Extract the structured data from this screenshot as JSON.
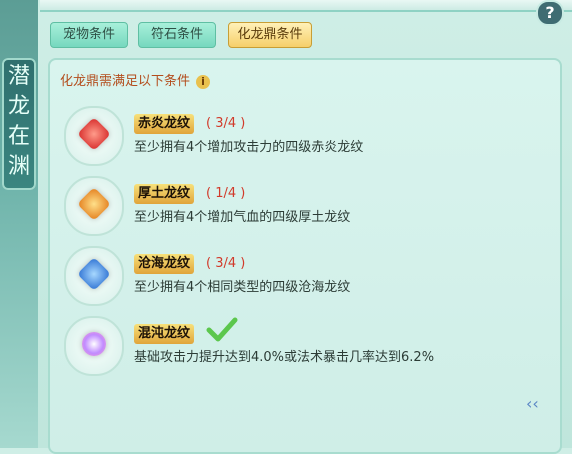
{
  "window": {
    "side_title_chars": [
      "潜",
      "龙",
      "在",
      "渊"
    ],
    "help_label": "?"
  },
  "tabs": [
    {
      "label": "宠物条件",
      "active": false
    },
    {
      "label": "符石条件",
      "active": false
    },
    {
      "label": "化龙鼎条件",
      "active": true
    }
  ],
  "panel": {
    "header": "化龙鼎需满足以下条件",
    "info_icon": "i"
  },
  "conditions": [
    {
      "icon": "red-gem-icon",
      "name": "赤炎龙纹",
      "progress": "( 3/4 )",
      "desc": "至少拥有4个增加攻击力的四级赤炎龙纹",
      "done": false
    },
    {
      "icon": "orange-gem-icon",
      "name": "厚土龙纹",
      "progress": "( 1/4 )",
      "desc": "至少拥有4个增加气血的四级厚土龙纹",
      "done": false
    },
    {
      "icon": "blue-gem-icon",
      "name": "沧海龙纹",
      "progress": "( 3/4 )",
      "desc": "至少拥有4个相同类型的四级沧海龙纹",
      "done": false
    },
    {
      "icon": "chaos-gem-icon",
      "name": "混沌龙纹",
      "progress": "",
      "desc": "基础攻击力提升达到4.0%或法术暴击几率达到6.2%",
      "done": true
    }
  ],
  "colors": {
    "accent_tab": "#f6cf6a",
    "progress_red": "#d23a2a",
    "header_text": "#b34d1d",
    "check_green": "#5cc74d"
  }
}
